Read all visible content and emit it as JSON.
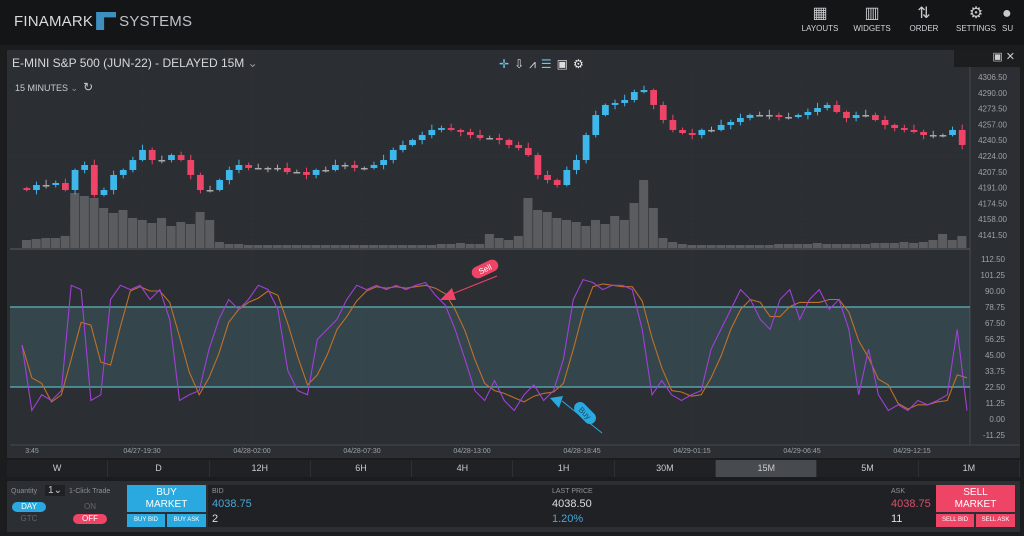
{
  "app": {
    "brand_left": "FINAMARK",
    "brand_right": "SYSTEMS"
  },
  "nav": [
    {
      "label": "LAYOUTS",
      "icon": "layouts-grid-icon"
    },
    {
      "label": "WIDGETS",
      "icon": "widgets-icon"
    },
    {
      "label": "ORDER",
      "icon": "order-arrows-icon"
    },
    {
      "label": "SETTINGS",
      "icon": "gear-icon"
    },
    {
      "label": "SU",
      "icon": "support-icon"
    }
  ],
  "chart_header": {
    "title": "E-MINI S&P 500 (JUN-22) - DELAYED 15M",
    "interval": "15 MINUTES",
    "tools": [
      "crosshair-icon",
      "marker-icon",
      "line-chart-icon",
      "layers-icon",
      "calendar-icon",
      "gear-icon"
    ]
  },
  "colors": {
    "up": "#3db8ec",
    "down": "#ef4468",
    "volume": "#5a5c5f",
    "k_line": "#a040d8",
    "d_line": "#c07028",
    "band": "#5fb4c0",
    "buy": "#29a9e0",
    "sell": "#ee4466"
  },
  "chart_data": [
    {
      "type": "candlestick",
      "title": "",
      "ylim": [
        4141.5,
        4306.5
      ],
      "yticks": [
        "4306.50",
        "4290.00",
        "4273.50",
        "4257.00",
        "4240.50",
        "4224.00",
        "4207.50",
        "4191.00",
        "4174.50",
        "4158.00",
        "4141.50"
      ],
      "xticks": [
        "3:45",
        "04/27-19:30",
        "04/28-02:00",
        "04/28-07:30",
        "04/28-13:00",
        "04/28-18:45",
        "04/29-01:15",
        "04/29-06:45",
        "04/29-12:15"
      ],
      "close": [
        4188.5,
        4193.7,
        4193.7,
        4195.8,
        4188.5,
        4209.4,
        4214.6,
        4183.3,
        4188.5,
        4204.2,
        4209.4,
        4219.8,
        4230.3,
        4219.8,
        4219.8,
        4225.0,
        4219.8,
        4204.2,
        4188.5,
        4188.5,
        4198.9,
        4209.4,
        4214.6,
        4211.5,
        4211.5,
        4211.5,
        4211.5,
        4207.3,
        4207.3,
        4204.2,
        4209.4,
        4209.4,
        4214.6,
        4214.6,
        4211.5,
        4211.5,
        4214.6,
        4219.8,
        4230.3,
        4235.5,
        4240.7,
        4245.9,
        4251.2,
        4253.2,
        4251.2,
        4249.1,
        4245.9,
        4242.8,
        4242.8,
        4240.7,
        4235.5,
        4232.4,
        4225.0,
        4204.2,
        4198.9,
        4193.7,
        4209.4,
        4219.8,
        4245.9,
        4266.8,
        4277.3,
        4279.4,
        4282.5,
        4290.8,
        4292.9,
        4277.3,
        4261.6,
        4251.2,
        4248.0,
        4245.9,
        4251.2,
        4251.2,
        4256.4,
        4259.5,
        4263.7,
        4266.8,
        4266.8,
        4266.8,
        4264.7,
        4264.7,
        4266.8,
        4270.0,
        4274.1,
        4277.3,
        4270.0,
        4263.7,
        4266.8,
        4266.8,
        4261.6,
        4256.4,
        4253.2,
        4251.2,
        4249.1,
        4245.9,
        4245.9,
        4245.9,
        4251.2,
        4235.5
      ],
      "volume": [
        8,
        9,
        10,
        10,
        12,
        55,
        52,
        50,
        40,
        35,
        38,
        30,
        28,
        25,
        30,
        22,
        26,
        24,
        36,
        28,
        6,
        4,
        4,
        3,
        3,
        3,
        3,
        3,
        3,
        3,
        3,
        3,
        3,
        3,
        3,
        3,
        3,
        3,
        3,
        3,
        3,
        3,
        3,
        4,
        4,
        5,
        4,
        4,
        14,
        10,
        8,
        12,
        50,
        38,
        36,
        30,
        28,
        26,
        22,
        28,
        24,
        32,
        28,
        45,
        68,
        40,
        10,
        6,
        4,
        3,
        3,
        3,
        3,
        3,
        3,
        3,
        3,
        3,
        4,
        4,
        4,
        4,
        5,
        4,
        4,
        4,
        4,
        4,
        5,
        5,
        5,
        6,
        5,
        6,
        8,
        14,
        8,
        12
      ]
    },
    {
      "type": "line",
      "title": "",
      "ylim": [
        -11.25,
        112.5
      ],
      "yticks": [
        "112.50",
        "101.25",
        "90.00",
        "78.75",
        "67.50",
        "56.25",
        "45.00",
        "33.75",
        "22.50",
        "11.25",
        "0.00",
        "-11.25"
      ],
      "band": [
        22.5,
        78.75
      ],
      "series": [
        {
          "values": [
            52,
            6,
            17,
            13,
            20,
            94,
            91,
            13,
            17,
            84,
            94,
            91,
            94,
            84,
            91,
            70,
            13,
            17,
            20,
            49,
            70,
            84,
            77,
            84,
            94,
            91,
            77,
            34,
            20,
            17,
            56,
            63,
            70,
            84,
            94,
            91,
            94,
            91,
            94,
            91,
            94,
            96,
            87,
            80,
            63,
            42,
            20,
            13,
            27,
            13,
            6,
            17,
            24,
            13,
            20,
            42,
            84,
            98,
            96,
            91,
            94,
            94,
            91,
            63,
            17,
            27,
            17,
            13,
            17,
            20,
            49,
            63,
            77,
            91,
            84,
            70,
            63,
            84,
            91,
            70,
            84,
            91,
            77,
            84,
            63,
            17,
            49,
            17,
            6,
            10,
            6,
            13,
            10,
            13,
            17,
            63,
            6
          ]
        },
        {
          "values": [
            52,
            29,
            25,
            12,
            17,
            42,
            68,
            66,
            40,
            38,
            65,
            90,
            93,
            90,
            90,
            82,
            58,
            33,
            17,
            29,
            46,
            68,
            77,
            82,
            85,
            90,
            87,
            67,
            44,
            24,
            31,
            45,
            63,
            72,
            83,
            90,
            93,
            92,
            93,
            92,
            93,
            94,
            92,
            88,
            77,
            62,
            42,
            25,
            20,
            18,
            15,
            12,
            16,
            18,
            19,
            25,
            49,
            75,
            93,
            95,
            94,
            93,
            93,
            83,
            57,
            36,
            20,
            19,
            16,
            17,
            29,
            44,
            63,
            77,
            84,
            82,
            72,
            72,
            79,
            82,
            82,
            82,
            84,
            84,
            75,
            55,
            43,
            28,
            24,
            11,
            7,
            10,
            10,
            12,
            13,
            31,
            29
          ]
        }
      ],
      "annotations": [
        {
          "text": "Sell",
          "color": "#ee4466"
        },
        {
          "text": "Buy",
          "color": "#29a9e0"
        }
      ]
    }
  ],
  "timeframes": [
    "W",
    "D",
    "12H",
    "6H",
    "4H",
    "1H",
    "30M",
    "15M",
    "5M",
    "1M"
  ],
  "active_timeframe": "15M",
  "trade": {
    "quantity_label": "Quantity",
    "quantity": "1",
    "one_click_label": "1-Click Trade",
    "day": "DAY",
    "gtc": "GTC",
    "on": "ON",
    "off": "OFF",
    "buy_label": "BUY",
    "buy_sub": "MARKET",
    "buy_bid": "BUY BID",
    "buy_ask": "BUY ASK",
    "bid_label": "BID",
    "bid": "4038.75",
    "bid_size": "2",
    "last_label": "LAST PRICE",
    "last": "4038.50",
    "change": "1.20%",
    "ask_label": "ASK",
    "ask": "4038.75",
    "ask_size": "11",
    "sell_label": "SELL",
    "sell_sub": "MARKET",
    "sell_bid": "SELL BID",
    "sell_ask": "SELL ASK"
  }
}
